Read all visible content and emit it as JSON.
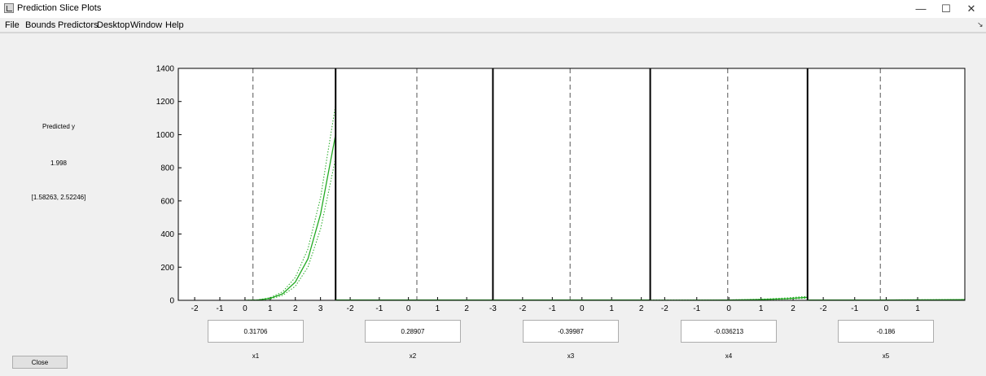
{
  "window": {
    "title": "Prediction Slice Plots"
  },
  "menu": [
    "File",
    "Bounds",
    "Predictors",
    "Desktop",
    "Window",
    "Help"
  ],
  "side": {
    "label": "Predicted y",
    "value": "1.998",
    "interval": "[1.58263, 2.52246]"
  },
  "close_label": "Close",
  "chart_data": {
    "type": "line",
    "ylim": [
      0,
      1400
    ],
    "yticks": [
      0,
      200,
      400,
      600,
      800,
      1000,
      1200,
      1400
    ],
    "grid": false,
    "colors": {
      "fit": "#22aa22",
      "bounds": "#22aa22",
      "current": "#555555",
      "axes": "#000000"
    },
    "panels": [
      {
        "name": "x1",
        "value": "0.31706",
        "current_x": 0.31706,
        "xlim": [
          -2.65,
          3.6
        ],
        "xticks": [
          -2,
          -1,
          0,
          1,
          2,
          3
        ],
        "fit": [
          [
            0,
            0
          ],
          [
            0.5,
            2
          ],
          [
            1,
            12
          ],
          [
            1.5,
            40
          ],
          [
            2,
            110
          ],
          [
            2.5,
            250
          ],
          [
            3,
            520
          ],
          [
            3.3,
            760
          ],
          [
            3.6,
            1000
          ]
        ],
        "lower": [
          [
            0,
            0
          ],
          [
            0.5,
            1
          ],
          [
            1,
            8
          ],
          [
            1.5,
            30
          ],
          [
            2,
            85
          ],
          [
            2.5,
            200
          ],
          [
            3,
            430
          ],
          [
            3.3,
            640
          ],
          [
            3.6,
            860
          ]
        ],
        "upper": [
          [
            0,
            0
          ],
          [
            0.5,
            3
          ],
          [
            1,
            16
          ],
          [
            1.5,
            52
          ],
          [
            2,
            138
          ],
          [
            2.5,
            310
          ],
          [
            3,
            620
          ],
          [
            3.3,
            900
          ],
          [
            3.6,
            1180
          ]
        ]
      },
      {
        "name": "x2",
        "value": "0.28907",
        "current_x": 0.28907,
        "xlim": [
          -2.5,
          2.9
        ],
        "xticks": [
          -2,
          -1,
          0,
          1,
          2
        ],
        "fit": [
          [
            -2.5,
            2
          ],
          [
            0,
            2
          ],
          [
            2.9,
            2
          ]
        ],
        "lower": [
          [
            -2.5,
            1.5
          ],
          [
            0,
            1.5
          ],
          [
            2.9,
            1.5
          ]
        ],
        "upper": [
          [
            -2.5,
            2.6
          ],
          [
            0,
            2.6
          ],
          [
            2.9,
            2.6
          ]
        ]
      },
      {
        "name": "x3",
        "value": "-0.39987",
        "current_x": -0.39987,
        "xlim": [
          -3,
          2.3
        ],
        "xticks": [
          -3,
          -2,
          -1,
          0,
          1,
          2
        ],
        "fit": [
          [
            -3,
            2
          ],
          [
            0,
            2
          ],
          [
            2.3,
            2
          ]
        ],
        "lower": [
          [
            -3,
            1.5
          ],
          [
            0,
            1.5
          ],
          [
            2.3,
            1.5
          ]
        ],
        "upper": [
          [
            -3,
            2.6
          ],
          [
            0,
            2.6
          ],
          [
            2.3,
            2.6
          ]
        ]
      },
      {
        "name": "x4",
        "value": "-0.036213",
        "current_x": -0.036213,
        "xlim": [
          -2.45,
          2.45
        ],
        "xticks": [
          -2,
          -1,
          0,
          1,
          2
        ],
        "fit": [
          [
            -2.45,
            0.5
          ],
          [
            -1,
            1
          ],
          [
            0,
            2
          ],
          [
            1,
            5
          ],
          [
            1.8,
            10
          ],
          [
            2.45,
            18
          ]
        ],
        "lower": [
          [
            -2.45,
            0.3
          ],
          [
            -1,
            0.7
          ],
          [
            0,
            1.5
          ],
          [
            1,
            3.5
          ],
          [
            1.8,
            7
          ],
          [
            2.45,
            13
          ]
        ],
        "upper": [
          [
            -2.45,
            0.8
          ],
          [
            -1,
            1.4
          ],
          [
            0,
            2.6
          ],
          [
            1,
            7
          ],
          [
            1.8,
            14
          ],
          [
            2.45,
            24
          ]
        ]
      },
      {
        "name": "x5",
        "value": "-0.186",
        "current_x": -0.186,
        "xlim": [
          -2.5,
          2.5
        ],
        "xticks": [
          -2,
          -1,
          0,
          1
        ],
        "fit": [
          [
            -2.5,
            2
          ],
          [
            0,
            2
          ],
          [
            1.5,
            3
          ],
          [
            2.5,
            4
          ]
        ],
        "lower": [
          [
            -2.5,
            1.5
          ],
          [
            0,
            1.5
          ],
          [
            1.5,
            2
          ],
          [
            2.5,
            3
          ]
        ],
        "upper": [
          [
            -2.5,
            2.6
          ],
          [
            0,
            2.6
          ],
          [
            1.5,
            4
          ],
          [
            2.5,
            5.5
          ]
        ]
      }
    ]
  }
}
